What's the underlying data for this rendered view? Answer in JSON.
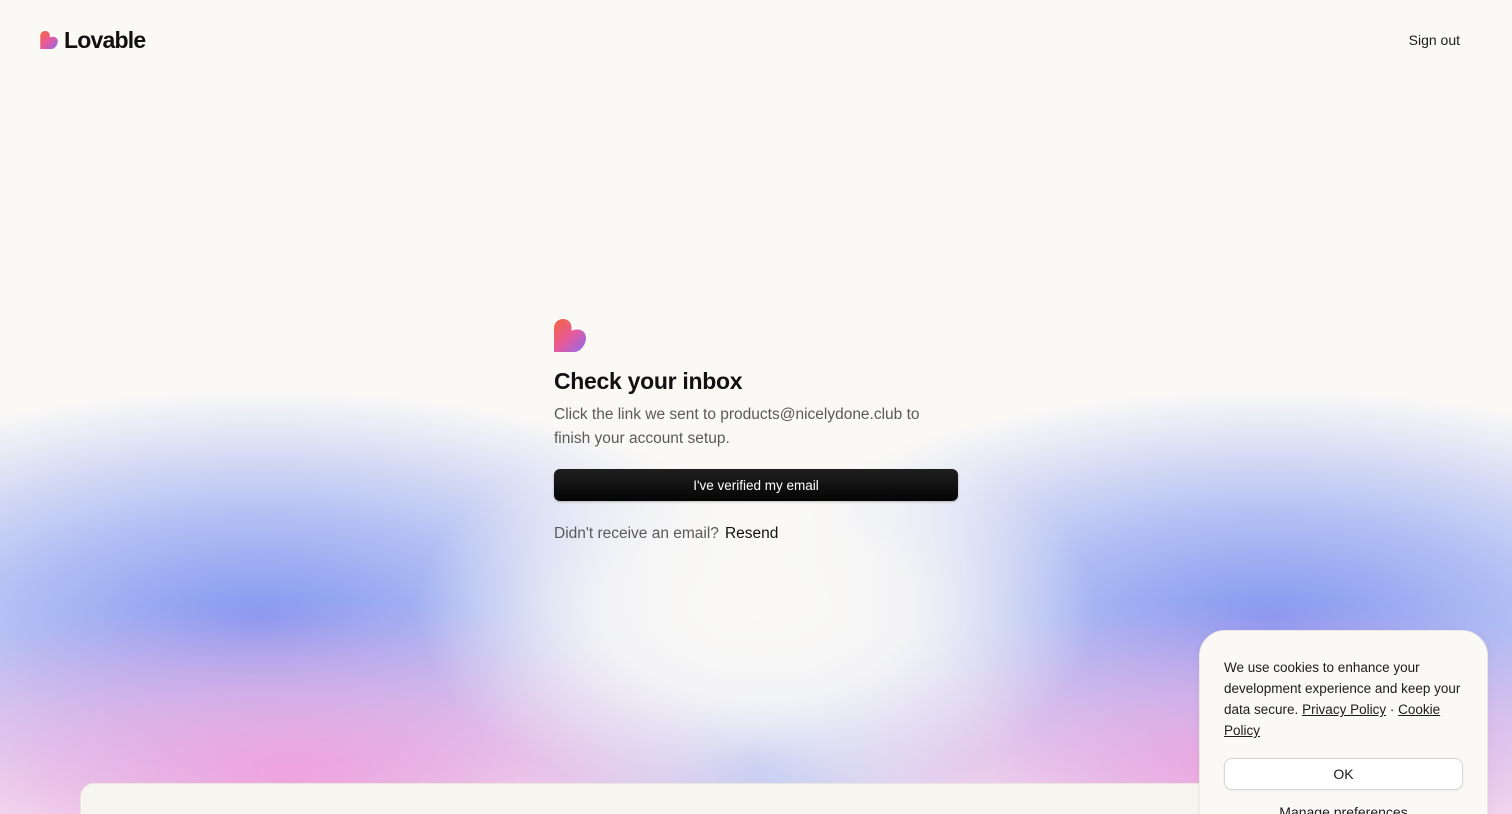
{
  "header": {
    "brand_name": "Lovable",
    "sign_out_label": "Sign out"
  },
  "main": {
    "title": "Check your inbox",
    "subtitle_line1": "Click the link we sent to products@nicelydone.club to",
    "subtitle_line2": "finish your account setup.",
    "verify_button_label": "I've verified my email",
    "resend_prompt": "Didn't receive an email?",
    "resend_label": "Resend"
  },
  "cookie_banner": {
    "text": "We use cookies to enhance your development experience and keep your data secure.",
    "privacy_link": "Privacy Policy",
    "separator": "·",
    "cookie_link": "Cookie Policy",
    "ok_label": "OK",
    "manage_label": "Manage preferences"
  },
  "colors": {
    "background": "#faf9f6",
    "button_dark": "#0b0b0b",
    "brand_orange": "#f2673a",
    "brand_pink": "#e85a9a",
    "brand_purple": "#8a6cf0",
    "glow_blue": "#7d91f0",
    "glow_pink": "#f0a0dc"
  },
  "icons": {
    "brand": "lovable-heart-logo-icon",
    "hero": "lovable-heart-logo-icon"
  }
}
